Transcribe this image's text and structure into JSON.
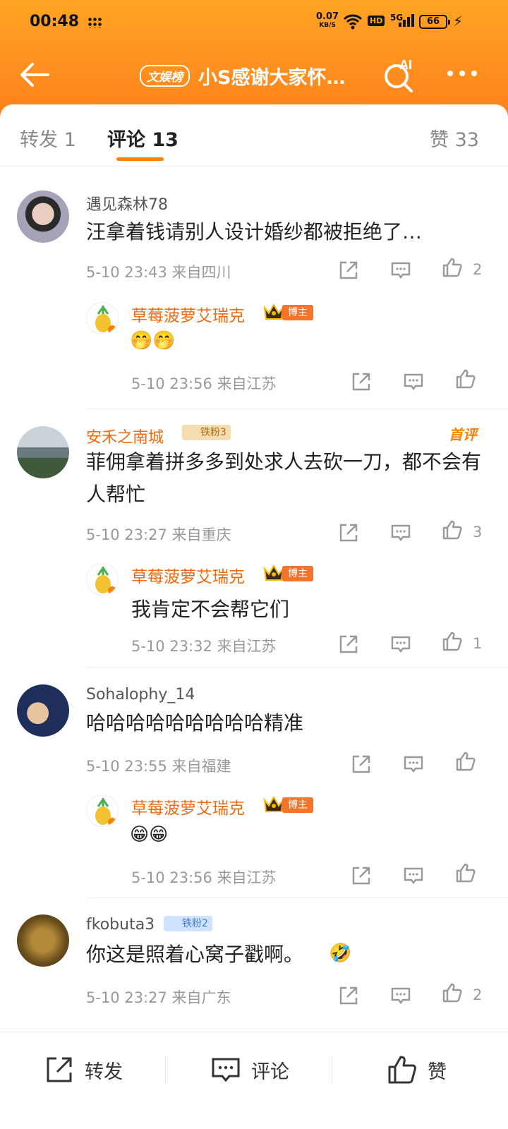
{
  "status_bar": {
    "time": "00:48",
    "net_speed_value": "0.07",
    "net_speed_unit": "KB/S",
    "hd": "HD",
    "signal": "5G",
    "battery": "66"
  },
  "header": {
    "tag": "文娱榜",
    "title": "小S感谢大家怀…",
    "ai_label": "AI"
  },
  "tabs": {
    "repost": "转发 1",
    "comments": "评论 13",
    "likes": "赞 33"
  },
  "comments": [
    {
      "user": "遇见森林78",
      "text": "汪拿着钱请别人设计婚纱都被拒绝了…",
      "time": "5-10 23:43",
      "location": "来自四川",
      "likes": "2",
      "reply": {
        "user": "草莓菠萝艾瑞克",
        "badge": "博主",
        "text": "",
        "emoji": "🤭🤭",
        "time": "5-10 23:56",
        "location": "来自江苏",
        "likes": ""
      }
    },
    {
      "user": "安禾之南城",
      "fan_badge": "铁粉3",
      "first_label": "首评",
      "text": "菲佣拿着拼多多到处求人去砍一刀，都不会有人帮忙",
      "time": "5-10 23:27",
      "location": "来自重庆",
      "likes": "3",
      "reply": {
        "user": "草莓菠萝艾瑞克",
        "badge": "博主",
        "text": "我肯定不会帮它们",
        "emoji": "",
        "time": "5-10 23:32",
        "location": "来自江苏",
        "likes": "1"
      }
    },
    {
      "user": "Sohalophy_14",
      "text": "哈哈哈哈哈哈哈哈哈精准",
      "time": "5-10 23:55",
      "location": "来自福建",
      "likes": "",
      "reply": {
        "user": "草莓菠萝艾瑞克",
        "badge": "博主",
        "text": "",
        "emoji": "😁😁",
        "time": "5-10 23:56",
        "location": "来自江苏",
        "likes": ""
      }
    },
    {
      "user": "fkobuta3",
      "fan_badge": "铁粉2",
      "text": "你这是照着心窝子戳啊。",
      "emoji": "🤣",
      "time": "5-10 23:27",
      "location": "来自广东",
      "likes": "2"
    }
  ],
  "bottom_bar": {
    "repost": "转发",
    "comment": "评论",
    "like": "赞"
  },
  "colors": {
    "brand_orange": "#ff8200",
    "header_top": "#ffa424",
    "header_bottom": "#ff7a1a"
  },
  "icons": [
    "back-arrow-icon",
    "ai-search-icon",
    "more-icon",
    "share-icon",
    "comment-icon",
    "like-icon",
    "crown-icon"
  ]
}
